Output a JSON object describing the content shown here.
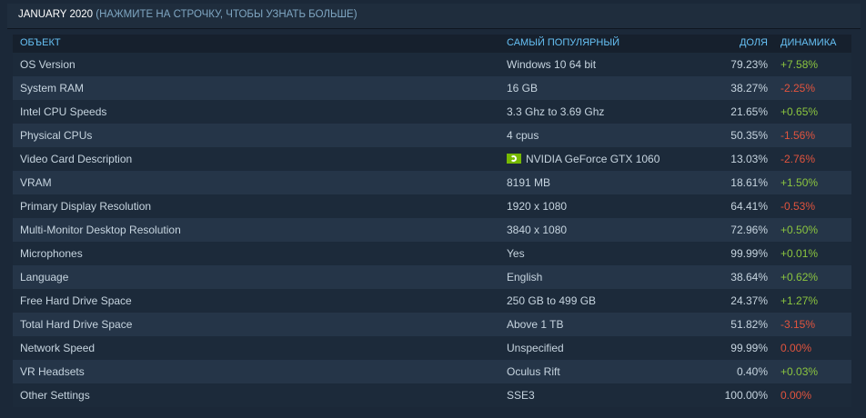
{
  "header": {
    "period": "JANUARY 2020",
    "hint": "(НАЖМИТЕ НА СТРОЧКУ, ЧТОБЫ УЗНАТЬ БОЛЬШЕ)"
  },
  "columns": {
    "item": "ОБЪЕКТ",
    "popular": "САМЫЙ ПОПУЛЯРНЫЙ",
    "share": "ДОЛЯ",
    "change": "ДИНАМИКА"
  },
  "rows": [
    {
      "item": "OS Version",
      "popular": "Windows 10 64 bit",
      "share": "79.23%",
      "change": "+7.58%",
      "dir": "pos"
    },
    {
      "item": "System RAM",
      "popular": "16 GB",
      "share": "38.27%",
      "change": "-2.25%",
      "dir": "neg"
    },
    {
      "item": "Intel CPU Speeds",
      "popular": "3.3 Ghz to 3.69 Ghz",
      "share": "21.65%",
      "change": "+0.65%",
      "dir": "pos"
    },
    {
      "item": "Physical CPUs",
      "popular": "4 cpus",
      "share": "50.35%",
      "change": "-1.56%",
      "dir": "neg"
    },
    {
      "item": "Video Card Description",
      "popular": "NVIDIA GeForce GTX 1060",
      "share": "13.03%",
      "change": "-2.76%",
      "dir": "neg",
      "icon": "nvidia-logo-icon"
    },
    {
      "item": "VRAM",
      "popular": "8191 MB",
      "share": "18.61%",
      "change": "+1.50%",
      "dir": "pos"
    },
    {
      "item": "Primary Display Resolution",
      "popular": "1920 x 1080",
      "share": "64.41%",
      "change": "-0.53%",
      "dir": "neg"
    },
    {
      "item": "Multi-Monitor Desktop Resolution",
      "popular": "3840 x 1080",
      "share": "72.96%",
      "change": "+0.50%",
      "dir": "pos"
    },
    {
      "item": "Microphones",
      "popular": "Yes",
      "share": "99.99%",
      "change": "+0.01%",
      "dir": "pos"
    },
    {
      "item": "Language",
      "popular": "English",
      "share": "38.64%",
      "change": "+0.62%",
      "dir": "pos"
    },
    {
      "item": "Free Hard Drive Space",
      "popular": "250 GB to 499 GB",
      "share": "24.37%",
      "change": "+1.27%",
      "dir": "pos"
    },
    {
      "item": "Total Hard Drive Space",
      "popular": "Above 1 TB",
      "share": "51.82%",
      "change": "-3.15%",
      "dir": "neg"
    },
    {
      "item": "Network Speed",
      "popular": "Unspecified",
      "share": "99.99%",
      "change": "0.00%",
      "dir": "neg"
    },
    {
      "item": "VR Headsets",
      "popular": "Oculus Rift",
      "share": "0.40%",
      "change": "+0.03%",
      "dir": "pos"
    },
    {
      "item": "Other Settings",
      "popular": "SSE3",
      "share": "100.00%",
      "change": "0.00%",
      "dir": "neg"
    }
  ],
  "colors": {
    "positive": "#8bc53f",
    "negative": "#e2543e",
    "header_text": "#66c0f4",
    "background": "#1b2838"
  }
}
